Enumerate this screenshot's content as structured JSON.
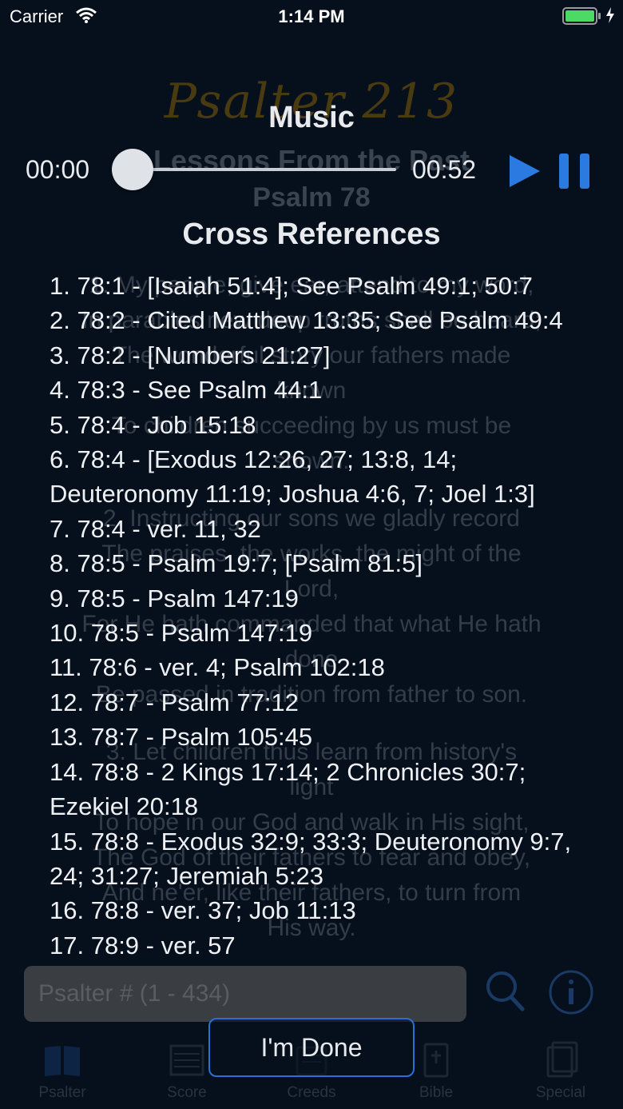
{
  "status_bar": {
    "carrier": "Carrier",
    "time": "1:14 PM",
    "icons": [
      "wifi-icon",
      "battery-icon",
      "charging-bolt-icon"
    ],
    "battery_color": "#4cd964"
  },
  "background": {
    "title": "Psalter 213",
    "subtitle": "Lessons From the Past",
    "psalm": "Psalm 78",
    "lines": [
      "1. My people, give ear, attend to my word,",
      "In parables new deep truths shall be heard;",
      "The wonderful story our fathers made",
      "known",
      "To children succeeding by us must be",
      "shown.",
      "2. Instructing our sons we gladly record",
      "The praises, the works, the might of the",
      "Lord,",
      "For He hath commanded that what He hath",
      "done",
      "Be passed in tradition from father to son.",
      "3. Let children thus learn from history's",
      "light",
      "To hope in our God and walk in His sight,",
      "The God of their fathers to fear and obey,",
      "And ne'er, like their fathers, to turn from",
      "His way."
    ],
    "search_placeholder": "Psalter # (1 - 434)"
  },
  "tab_bar": {
    "tabs": [
      {
        "label": "Psalter",
        "icon": "book-icon"
      },
      {
        "label": "Score",
        "icon": "score-icon"
      },
      {
        "label": "Creeds",
        "icon": "creeds-icon"
      },
      {
        "label": "Bible",
        "icon": "bible-icon"
      },
      {
        "label": "Special",
        "icon": "special-icon"
      }
    ]
  },
  "music": {
    "heading": "Music",
    "elapsed": "00:00",
    "total": "00:52",
    "progress": 0.0,
    "accent_color": "#2a7ae2"
  },
  "cross_references": {
    "heading": "Cross References",
    "items": [
      "1. 78:1 - [Isaiah 51:4]; See Psalm 49:1; 50:7",
      "2. 78:2 - Cited Matthew 13:35; See Psalm 49:4",
      "3. 78:2 - [Numbers 21:27]",
      "4. 78:3 - See Psalm 44:1",
      "5. 78:4 - Job 15:18",
      "6. 78:4 - [Exodus 12:26, 27; 13:8, 14; Deuteronomy 11:19; Joshua 4:6, 7; Joel 1:3]",
      "7. 78:4 - ver. 11, 32",
      "8. 78:5 - Psalm 19:7; [Psalm 81:5]",
      "9. 78:5 - Psalm 147:19",
      "10. 78:5 - Psalm 147:19",
      "11. 78:6 - ver. 4; Psalm 102:18",
      "12. 78:7 - Psalm 77:12",
      "13. 78:7 - Psalm 105:45",
      "14. 78:8 - 2 Kings 17:14; 2 Chronicles 30:7; Ezekiel 20:18",
      "15. 78:8 - Exodus 32:9; 33:3; Deuteronomy 9:7, 24; 31:27; Jeremiah 5:23",
      "16. 78:8 - ver. 37; Job 11:13",
      "17. 78:9 - ver. 57"
    ]
  },
  "done_button": {
    "label": "I'm Done"
  }
}
